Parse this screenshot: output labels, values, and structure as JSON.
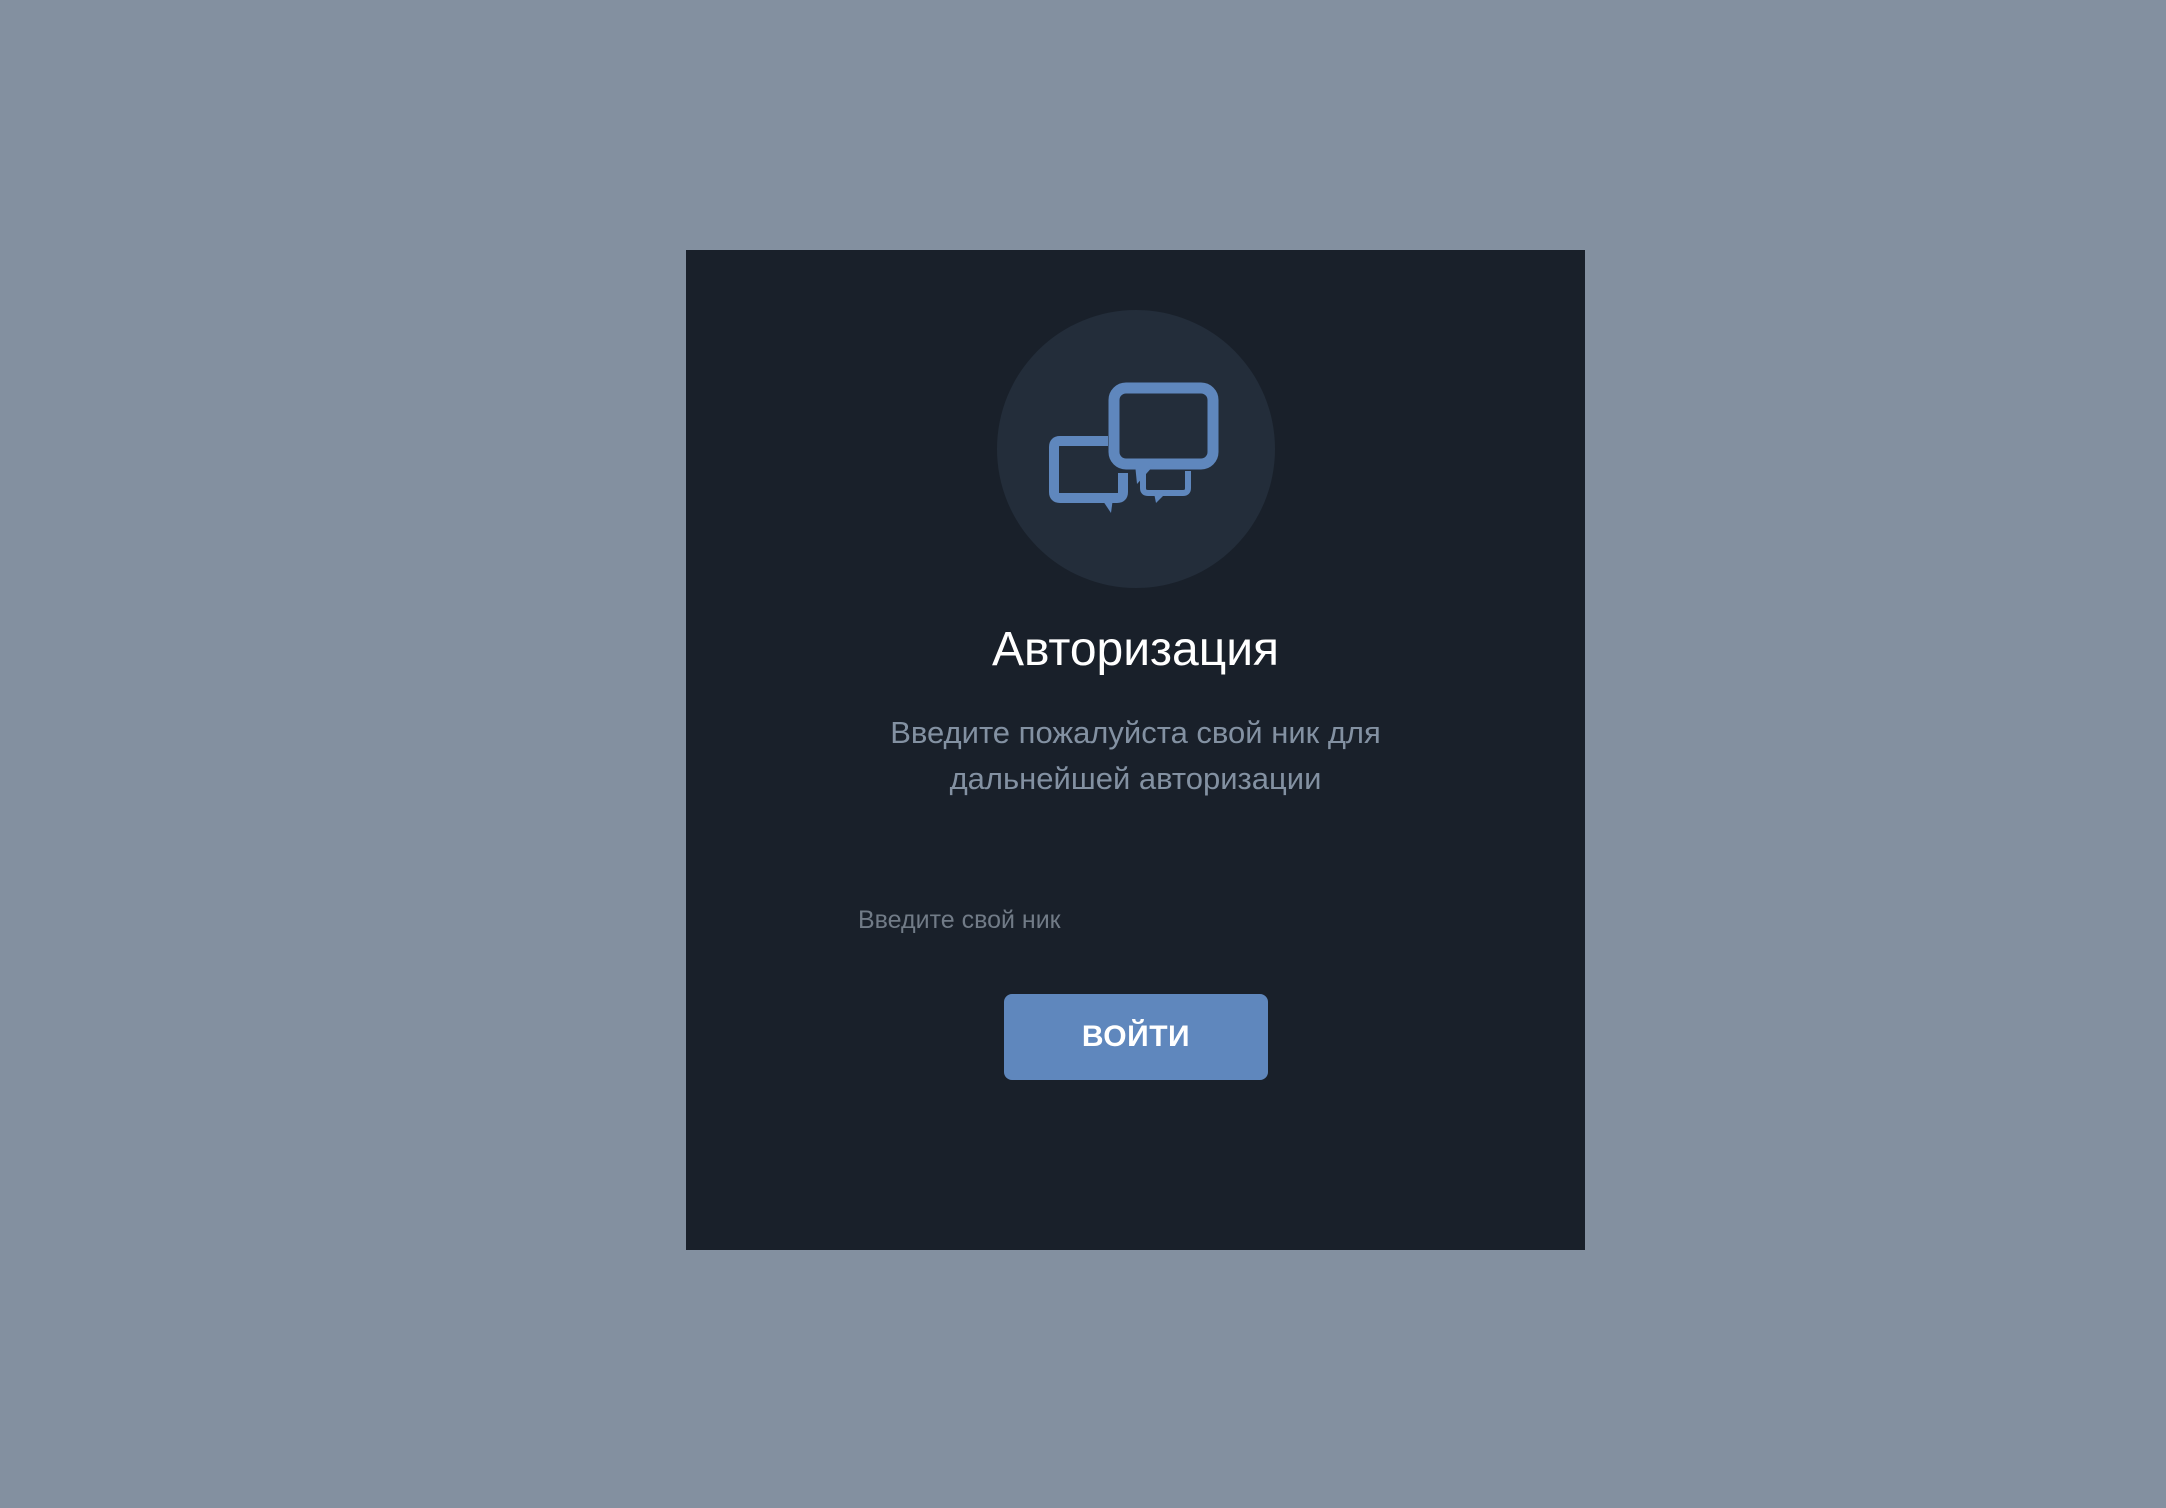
{
  "auth": {
    "title": "Авторизация",
    "subtitle": "Введите пожалуйста свой ник для дальнейшей авторизации",
    "nick_input": {
      "value": "",
      "placeholder": "Введите свой ник"
    },
    "login_label": "ВОЙТИ"
  },
  "icons": {
    "logo": "chat-bubbles-icon"
  },
  "colors": {
    "page_background": "#8390a0",
    "card_background": "#19202a",
    "avatar_background": "#232d3a",
    "accent": "#5f87bd",
    "title_text": "#ffffff",
    "subtitle_text": "#8391a2",
    "placeholder_text": "#717b87"
  }
}
